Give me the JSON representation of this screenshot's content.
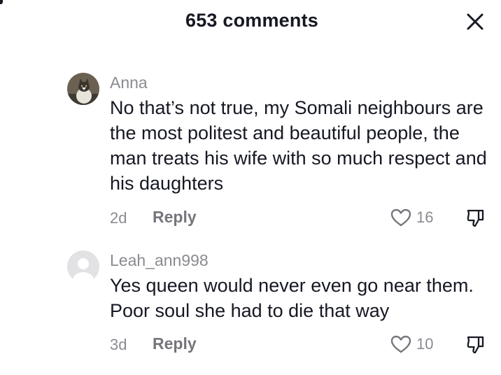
{
  "header": {
    "title": "653 comments",
    "close_icon": "close-icon"
  },
  "comments": [
    {
      "username": "Anna",
      "avatar": "cat-photo-avatar",
      "text": "No that’s not true, my Somali neighbours are the most politest and beautiful people, the man treats his wife with so much respect and his daughters",
      "date": "2d",
      "reply_label": "Reply",
      "likes": "16"
    },
    {
      "username": "Leah_ann998",
      "avatar": "default-user-avatar",
      "text": "Yes queen would never even go near them. Poor soul she had to die that way",
      "date": "3d",
      "reply_label": "Reply",
      "likes": "10"
    }
  ],
  "colors": {
    "text_primary": "#161823",
    "text_secondary": "#8a8b91"
  }
}
